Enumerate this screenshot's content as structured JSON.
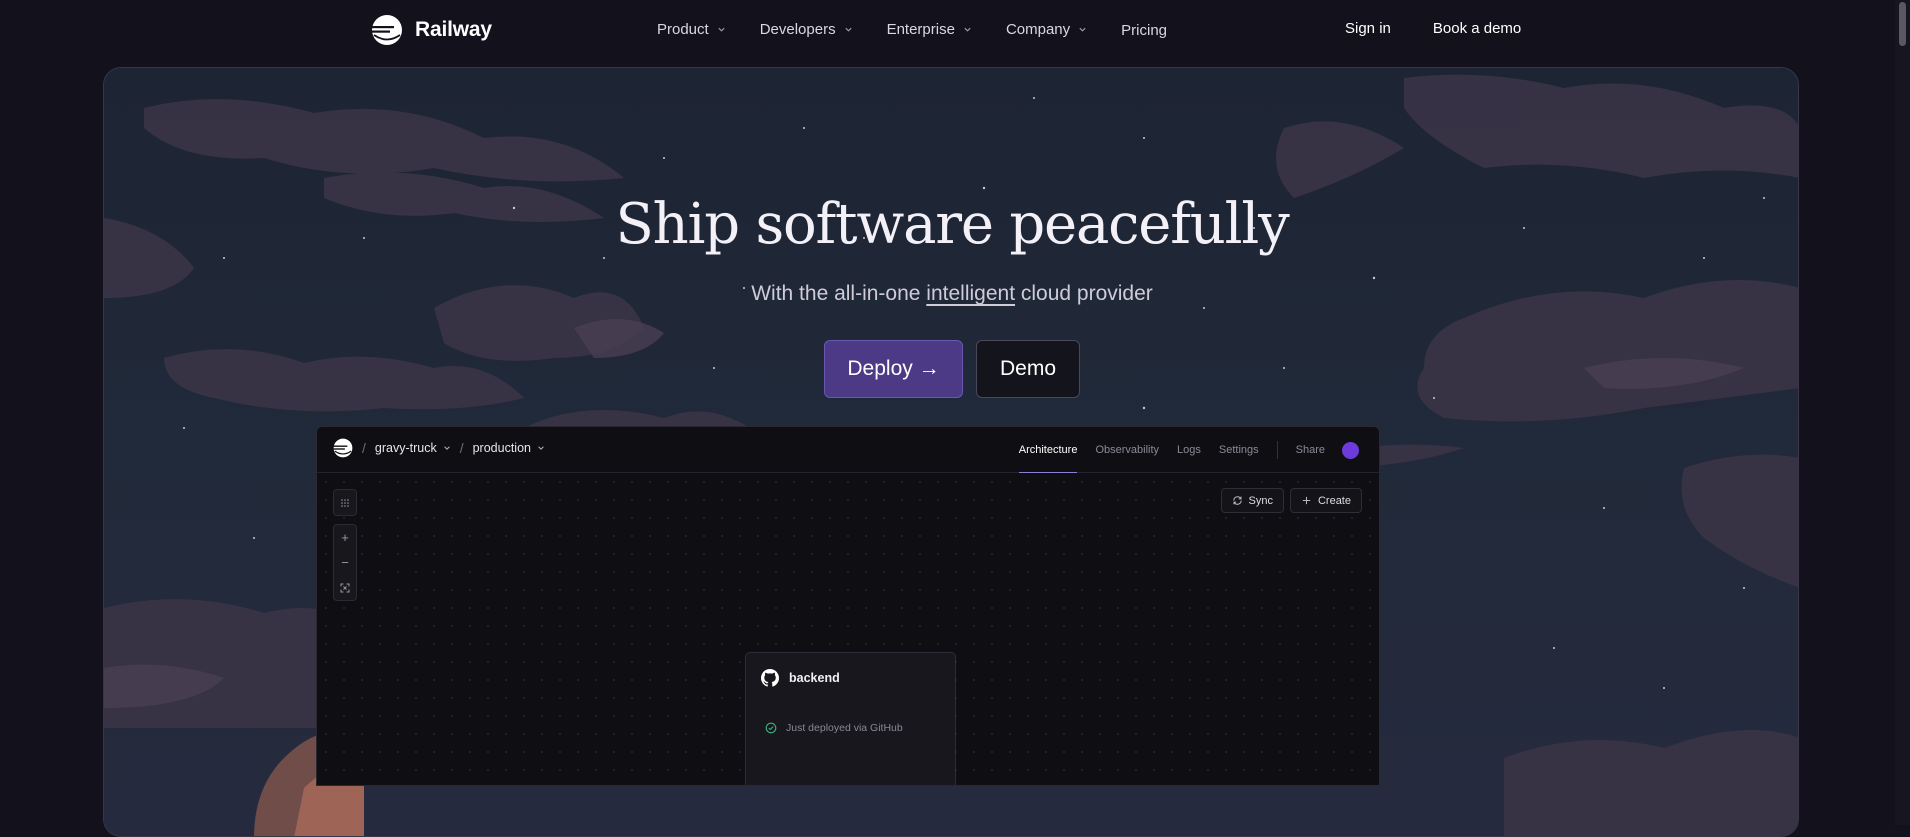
{
  "nav": {
    "brand": "Railway",
    "links": [
      {
        "label": "Product",
        "has_dropdown": true
      },
      {
        "label": "Developers",
        "has_dropdown": true
      },
      {
        "label": "Enterprise",
        "has_dropdown": true
      },
      {
        "label": "Company",
        "has_dropdown": true
      },
      {
        "label": "Pricing",
        "has_dropdown": false
      }
    ],
    "sign_in": "Sign in",
    "book_demo": "Book a demo"
  },
  "hero": {
    "title": "Ship software peacefully",
    "subtitle_before": "With the all-in-one ",
    "subtitle_link": "intelligent",
    "subtitle_after": " cloud provider",
    "deploy_label": "Deploy →",
    "demo_label": "Demo"
  },
  "dashboard": {
    "project": "gravy-truck",
    "environment": "production",
    "tabs": [
      {
        "label": "Architecture",
        "active": true
      },
      {
        "label": "Observability",
        "active": false
      },
      {
        "label": "Logs",
        "active": false
      },
      {
        "label": "Settings",
        "active": false
      }
    ],
    "share_label": "Share",
    "sync_label": "Sync",
    "create_label": "Create",
    "zoom_in": "+",
    "zoom_out": "−",
    "service": {
      "name": "backend",
      "status": "Just deployed via GitHub"
    }
  },
  "colors": {
    "page_bg": "#13111c",
    "deploy_button": "#4c3a86",
    "avatar": "#6d3bdc",
    "status_ok": "#3fb27f"
  }
}
